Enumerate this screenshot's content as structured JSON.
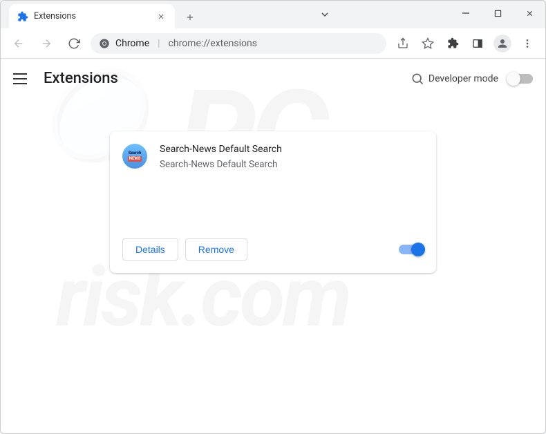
{
  "tab": {
    "title": "Extensions"
  },
  "address": {
    "scheme": "Chrome",
    "path": "chrome://extensions"
  },
  "header": {
    "title": "Extensions",
    "devmode_label": "Developer mode",
    "devmode_on": false
  },
  "extension": {
    "name": "Search-News Default Search",
    "description": "Search-News Default Search",
    "details_label": "Details",
    "remove_label": "Remove",
    "enabled": true
  }
}
